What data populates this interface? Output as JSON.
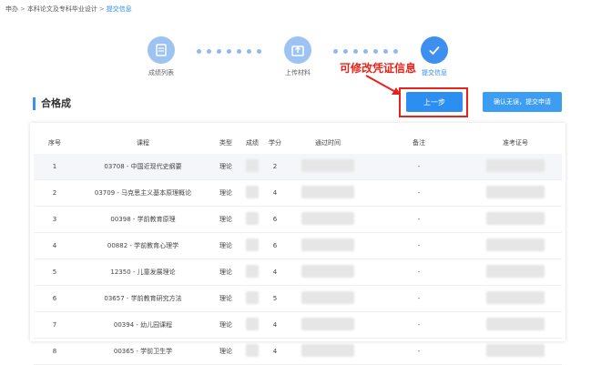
{
  "breadcrumb": {
    "items": [
      "申办",
      "本科论文及专科毕业设计",
      "提交信息"
    ],
    "separator": ">"
  },
  "steps": [
    {
      "label": "成绩列表",
      "icon": "list-icon",
      "active": false
    },
    {
      "label": "上传材料",
      "icon": "upload-icon",
      "active": false
    },
    {
      "label": "提交信息",
      "icon": "check-icon",
      "active": true
    }
  ],
  "annotation": "可修改凭证信息",
  "section_title": "合格成",
  "buttons": {
    "prev": "上一步",
    "submit": "确认无误，提交申请"
  },
  "table": {
    "headers": [
      "序号",
      "课程",
      "类型",
      "成绩",
      "学分",
      "通过时间",
      "备注",
      "准考证号"
    ],
    "rows": [
      {
        "no": "1",
        "course": "03708 - 中国近现代史纲要",
        "type": "理论",
        "credit": "2",
        "note": "-"
      },
      {
        "no": "2",
        "course": "03709 - 马克思主义基本原理概论",
        "type": "理论",
        "credit": "4",
        "note": "-"
      },
      {
        "no": "3",
        "course": "00398 - 学前教育原理",
        "type": "理论",
        "credit": "6",
        "note": "-"
      },
      {
        "no": "4",
        "course": "00882 - 学前教育心理学",
        "type": "理论",
        "credit": "6",
        "note": "-"
      },
      {
        "no": "5",
        "course": "12350 - 儿童发展理论",
        "type": "理论",
        "credit": "4",
        "note": "-"
      },
      {
        "no": "6",
        "course": "03657 - 学前教育研究方法",
        "type": "理论",
        "credit": "5",
        "note": "-"
      },
      {
        "no": "7",
        "course": "00394 - 幼儿园课程",
        "type": "理论",
        "credit": "4",
        "note": "-"
      },
      {
        "no": "8",
        "course": "00365 - 学前卫生学",
        "type": "理论",
        "credit": "4",
        "note": "-"
      }
    ]
  },
  "colors": {
    "accent": "#2b8ef0",
    "annotation": "#e8231b"
  }
}
